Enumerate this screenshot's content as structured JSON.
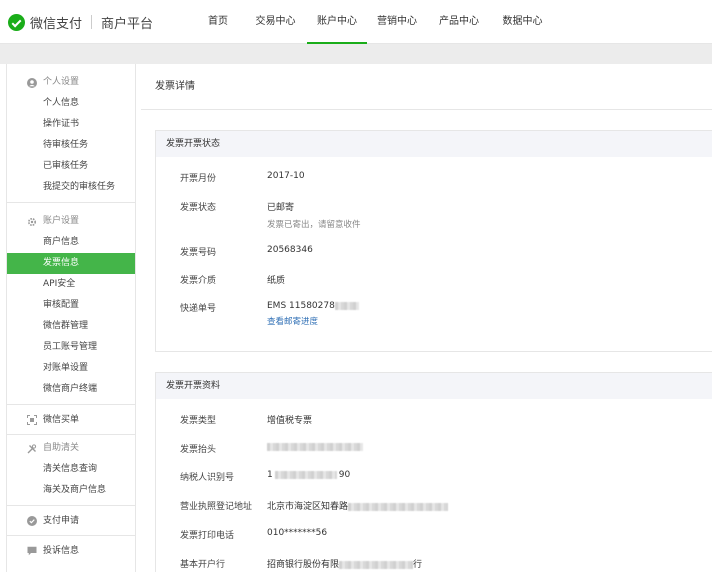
{
  "brand": {
    "name": "微信支付",
    "sub": "商户平台"
  },
  "nav": [
    {
      "label": "首页",
      "active": false
    },
    {
      "label": "交易中心",
      "active": false
    },
    {
      "label": "账户中心",
      "active": true
    },
    {
      "label": "营销中心",
      "active": false
    },
    {
      "label": "产品中心",
      "active": false
    },
    {
      "label": "数据中心",
      "active": false
    }
  ],
  "sidebar": {
    "personal": {
      "title": "个人设置",
      "items": [
        "个人信息",
        "操作证书",
        "待审核任务",
        "已审核任务",
        "我提交的审核任务"
      ]
    },
    "account": {
      "title": "账户设置",
      "items": [
        "商户信息",
        "发票信息",
        "API安全",
        "审核配置",
        "微信群管理",
        "员工账号管理",
        "对账单设置",
        "微信商户终端"
      ],
      "active_index": 1
    },
    "wechat_order": "微信买单",
    "customs": {
      "title": "自助清关",
      "items": [
        "清关信息查询",
        "海关及商户信息"
      ]
    },
    "payment_apply": "支付申请",
    "complaint": "投诉信息"
  },
  "page_title": "发票详情",
  "status_section": {
    "title": "发票开票状态",
    "month_label": "开票月份",
    "month": "2017-10",
    "status_label": "发票状态",
    "status": "已邮寄",
    "status_note": "发票已寄出，请留意收件",
    "number_label": "发票号码",
    "number": "20568346",
    "medium_label": "发票介质",
    "medium": "纸质",
    "tracking_label": "快递单号",
    "tracking": "EMS 11580278",
    "tracking_link": "查看邮寄进度"
  },
  "info_section": {
    "title": "发票开票资料",
    "type_label": "发票类型",
    "type": "增值税专票",
    "header_label": "发票抬头",
    "taxid_label": "纳税人识别号",
    "taxid_prefix": "1",
    "taxid_suffix": "90",
    "address_label": "营业执照登记地址",
    "address": "北京市海淀区知春路",
    "phone_label": "发票打印电话",
    "phone": "010*******56",
    "bank_label": "基本开户行",
    "bank_prefix": "招商银行股份有限",
    "bank_suffix": "行"
  }
}
